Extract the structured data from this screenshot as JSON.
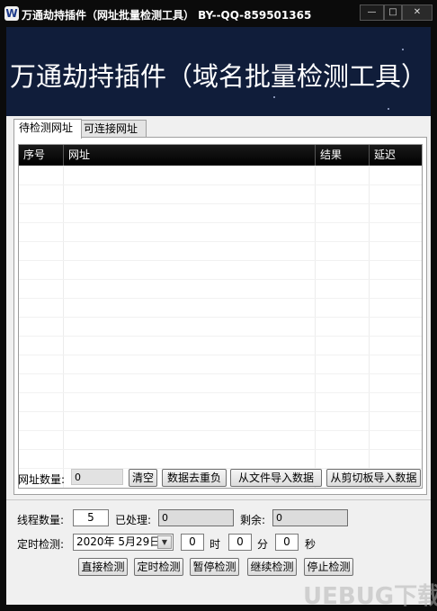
{
  "window": {
    "icon_letter": "W",
    "title": "万通劫持插件（网址批量检测工具） BY--QQ-859501365",
    "minimize_glyph": "—",
    "maximize_glyph": "□",
    "close_glyph": "✕"
  },
  "banner": {
    "text": "万通劫持插件（域名批量检测工具）",
    "bg_color": "#101d3a"
  },
  "tabs": [
    {
      "label": "待检测网址",
      "active": true
    },
    {
      "label": "可连接网址",
      "active": false
    }
  ],
  "grid": {
    "columns": [
      "序号",
      "网址",
      "结果",
      "延迟"
    ],
    "rows": []
  },
  "url_count": {
    "label": "网址数量:",
    "value": "0"
  },
  "list_buttons": {
    "clear": "清空",
    "dedupe": "数据去重负",
    "import_file": "从文件导入数据",
    "import_clipboard": "从剪切板导入数据"
  },
  "settings": {
    "threads_label": "线程数量:",
    "threads_value": "5",
    "processed_label": "已处理:",
    "processed_value": "0",
    "remaining_label": "剩余:",
    "remaining_value": "0",
    "schedule_label": "定时检测:",
    "date_value": "2020年  5月29日",
    "hour_value": "0",
    "hour_unit": "时",
    "minute_value": "0",
    "minute_unit": "分",
    "second_value": "0",
    "second_unit": "秒"
  },
  "action_buttons": {
    "direct": "直接检测",
    "scheduled": "定时检测",
    "pause": "暂停检测",
    "resume": "继续检测",
    "stop": "停止检测"
  },
  "watermark": "UEBUG下载"
}
